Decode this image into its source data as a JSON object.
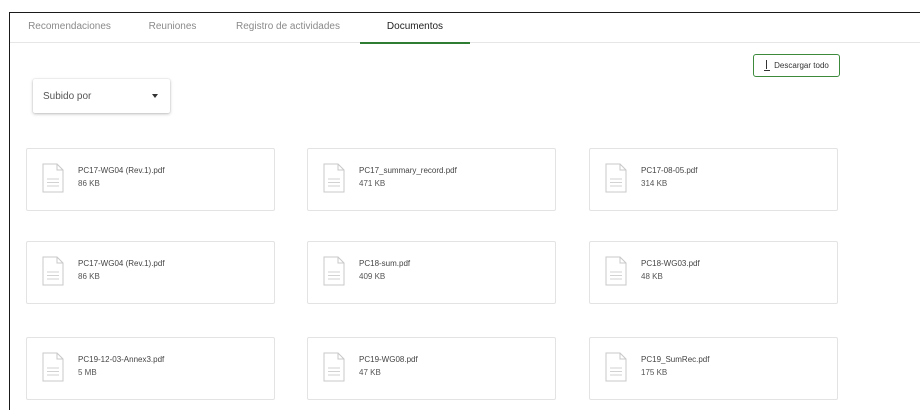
{
  "tabs": [
    {
      "label": "Recomendaciones",
      "active": false
    },
    {
      "label": "Reuniones",
      "active": false
    },
    {
      "label": "Registro de actividades",
      "active": false
    },
    {
      "label": "Documentos",
      "active": true
    }
  ],
  "toolbar": {
    "download_all_label": "Descargar todo",
    "download_icon": "download-icon"
  },
  "filter": {
    "selected": "Subido por",
    "icon": "caret-down-icon"
  },
  "colors": {
    "accent": "#2e7d32",
    "button_border": "#3d8a3d"
  },
  "documents": [
    {
      "name": "PC17-WG04 (Rev.1).pdf",
      "size": "86 KB"
    },
    {
      "name": "PC17_summary_record.pdf",
      "size": "471 KB"
    },
    {
      "name": "PC17-08-05.pdf",
      "size": "314 KB"
    },
    {
      "name": "PC17-WG04 (Rev.1).pdf",
      "size": "86 KB"
    },
    {
      "name": "PC18-sum.pdf",
      "size": "409 KB"
    },
    {
      "name": "PC18-WG03.pdf",
      "size": "48 KB"
    },
    {
      "name": "PC19-12-03-Annex3.pdf",
      "size": "5 MB"
    },
    {
      "name": "PC19-WG08.pdf",
      "size": "47 KB"
    },
    {
      "name": "PC19_SumRec.pdf",
      "size": "175 KB"
    }
  ],
  "document_icon": "file-document-icon"
}
